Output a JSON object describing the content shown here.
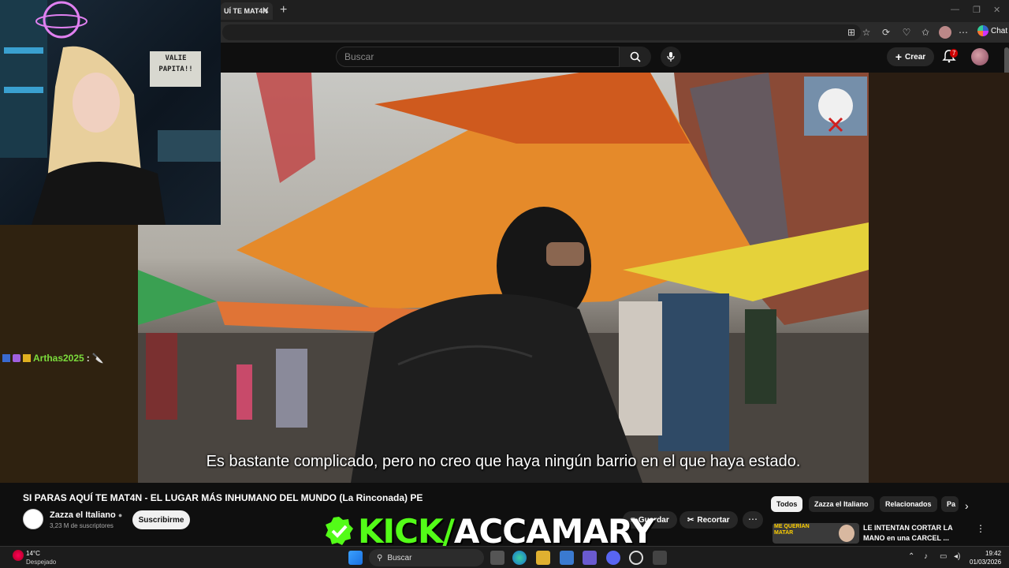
{
  "browser": {
    "tab_title": "UÍ TE MAT4N",
    "tab_close": "✕",
    "new_tab": "+",
    "copilot_label": "Chat",
    "minimize": "—",
    "restore": "❐",
    "close": "✕"
  },
  "youtube": {
    "search_placeholder": "Buscar",
    "create_label": "Crear",
    "notifications_count": "7"
  },
  "video": {
    "subtitle": "Es bastante complicado, pero no creo que haya ningún barrio en el que haya estado.",
    "title": "SI PARAS AQUÍ TE MAT4N - EL LUGAR MÁS INHUMANO DEL MUNDO (La Rinconada) PE",
    "channel_name": "Zazza el Italiano",
    "subscribers": "3,23 M de suscriptores",
    "subscribe_label": "Suscribirme",
    "actions": {
      "save": "Guardar",
      "clip": "Recortar",
      "more": "⋯"
    }
  },
  "webcam": {
    "sign_text": "VALIE PAPITA!!"
  },
  "chat": {
    "username": "Arthas2025",
    "separator": ":",
    "message": "🔪"
  },
  "chips": [
    "Todos",
    "Zazza el Italiano",
    "Relacionados",
    "Pa"
  ],
  "suggested": {
    "title": "LE INTENTAN CORTAR LA MANO en una CARCEL ...",
    "thumb_text": "ME QUERÍAN MATAR"
  },
  "overlay": {
    "kick_green": "KICK/",
    "kick_white": "ACCAMARY"
  },
  "taskbar": {
    "temperature": "14°C",
    "weather": "Despejado",
    "search_label": "Buscar",
    "time": "19:42",
    "date": "01/03/2026"
  },
  "colors": {
    "kick_green": "#53fc18",
    "youtube_bg": "#0f0f0f",
    "chat_username": "#7bdc3c"
  }
}
